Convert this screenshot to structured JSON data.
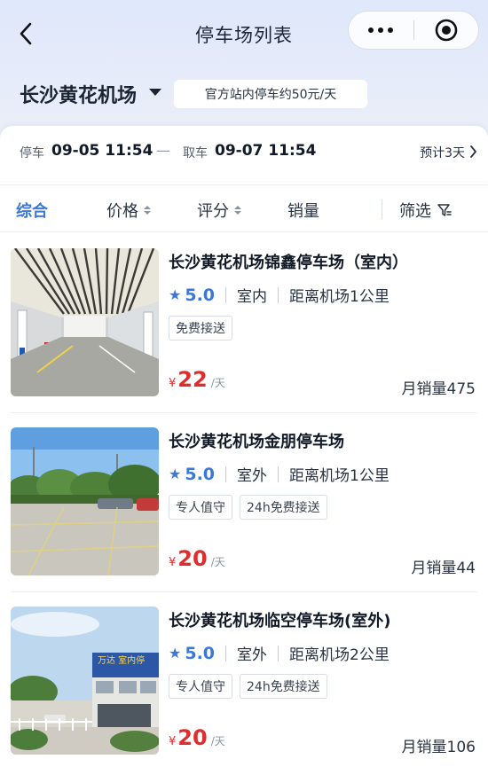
{
  "header": {
    "title": "停车场列表",
    "back_icon": "chevron-left-icon",
    "more_icon": "more-dots-icon",
    "target_icon": "target-circle-icon"
  },
  "location": {
    "city": "长沙黄花机场",
    "official_note": "官方站内停车约50元/天"
  },
  "time": {
    "park_label": "停车",
    "park_time": "09-05 11:54",
    "separator": "—",
    "pickup_label": "取车",
    "pickup_time": "09-07 11:54",
    "estimate": "预计3天"
  },
  "tabs": {
    "overall": "综合",
    "price": "价格",
    "rating": "评分",
    "sales": "销量",
    "filter": "筛选"
  },
  "lots": [
    {
      "name": "长沙黄花机场锦鑫停车场（室内）",
      "score": "5.0",
      "type": "室内",
      "distance": "距离机场1公里",
      "tags": [
        "免费接送"
      ],
      "currency": "¥",
      "price": "22",
      "unit": "/天",
      "sales": "月销量475"
    },
    {
      "name": "长沙黄花机场金朋停车场",
      "score": "5.0",
      "type": "室外",
      "distance": "距离机场1公里",
      "tags": [
        "专人值守",
        "24h免费接送"
      ],
      "currency": "¥",
      "price": "20",
      "unit": "/天",
      "sales": "月销量44"
    },
    {
      "name": "长沙黄花机场临空停车场(室外)",
      "score": "5.0",
      "type": "室外",
      "distance": "距离机场2公里",
      "tags": [
        "专人值守",
        "24h免费接送"
      ],
      "currency": "¥",
      "price": "20",
      "unit": "/天",
      "sales": "月销量106"
    }
  ],
  "thumb_signage": "万达 室内停",
  "colors": {
    "accent": "#3b78d8",
    "price": "#e02c2c"
  }
}
